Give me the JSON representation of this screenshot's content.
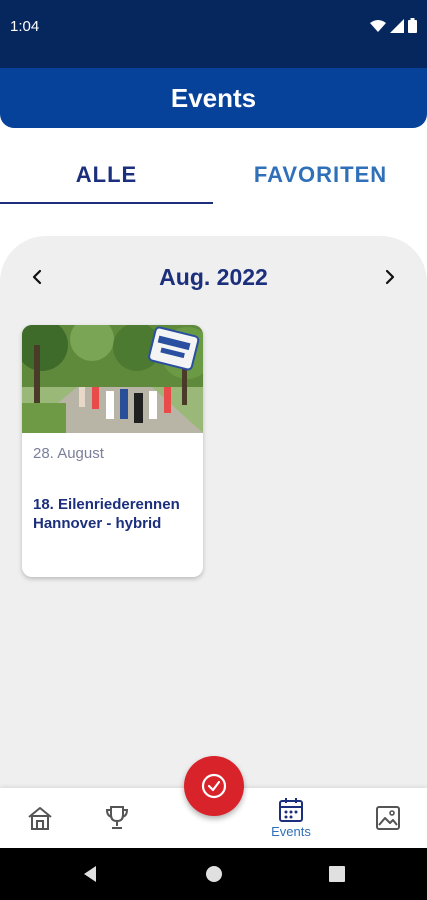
{
  "status_bar": {
    "time": "1:04",
    "icons": [
      "wifi-icon",
      "cell-signal-icon",
      "battery-icon"
    ]
  },
  "app_bar": {
    "title": "Events"
  },
  "tabs": [
    {
      "label": "ALLE",
      "selected": true
    },
    {
      "label": "FAVORITEN",
      "selected": false
    }
  ],
  "calendar": {
    "month_label": "Aug. 2022",
    "prev_icon": "chevron-left-icon",
    "next_icon": "chevron-right-icon"
  },
  "events": [
    {
      "date": "28. August",
      "title": "18. Eilenriederennen Hannover - hybrid",
      "image": "event-photo-runners-forest"
    }
  ],
  "bottom_nav": {
    "items": [
      {
        "icon": "home-icon",
        "label": ""
      },
      {
        "icon": "trophy-icon",
        "label": ""
      },
      {
        "icon": "calendar-icon",
        "label": "Events",
        "selected": true
      },
      {
        "icon": "image-icon",
        "label": ""
      }
    ],
    "fab_icon": "check-circle-icon"
  },
  "system_nav": [
    "back-icon",
    "home-circle-icon",
    "recents-icon"
  ],
  "colors": {
    "status_bar": "#05275e",
    "app_bar": "#07429a",
    "primary_text": "#1b2f7c",
    "accent_blue": "#2f70b8",
    "fab": "#d9232b",
    "content_bg": "#efefef"
  }
}
